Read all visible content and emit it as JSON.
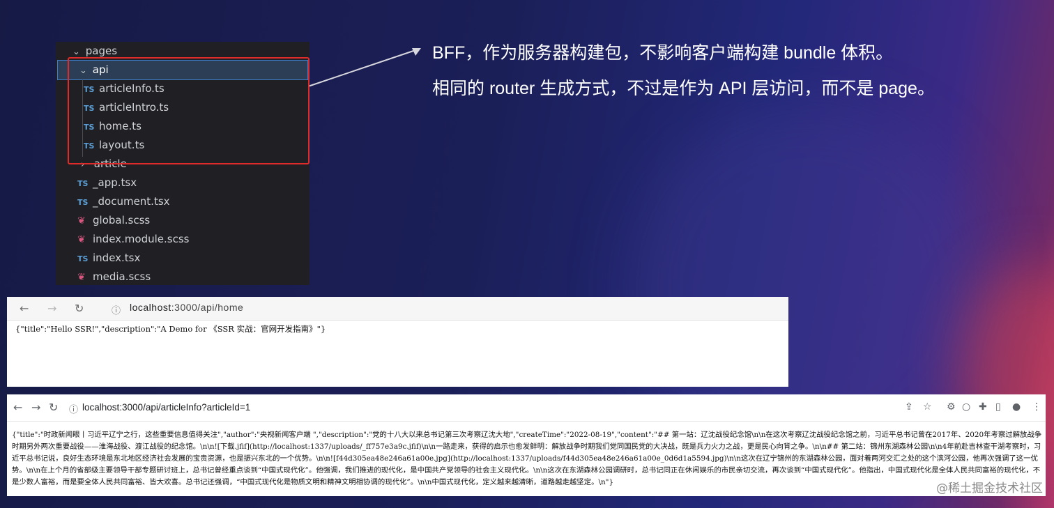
{
  "file_tree": {
    "items": [
      {
        "label": "pages",
        "kind": "folder-open"
      },
      {
        "label": "api",
        "kind": "folder-open",
        "selected": true
      },
      {
        "label": "articleInfo.ts",
        "kind": "ts"
      },
      {
        "label": "articleIntro.ts",
        "kind": "ts"
      },
      {
        "label": "home.ts",
        "kind": "ts"
      },
      {
        "label": "layout.ts",
        "kind": "ts"
      },
      {
        "label": "article",
        "kind": "folder-closed"
      },
      {
        "label": "_app.tsx",
        "kind": "ts"
      },
      {
        "label": "_document.tsx",
        "kind": "ts"
      },
      {
        "label": "global.scss",
        "kind": "scss"
      },
      {
        "label": "index.module.scss",
        "kind": "scss"
      },
      {
        "label": "index.tsx",
        "kind": "ts"
      },
      {
        "label": "media.scss",
        "kind": "scss"
      }
    ],
    "ts_badge": "TS"
  },
  "description": {
    "line1": "BFF，作为服务器构建包，不影响客户端构建 bundle 体积。",
    "line2": "相同的 router 生成方式，不过是作为 API 层访问，而不是 page。"
  },
  "browser_home": {
    "url_host": "localhost",
    "url_rest": ":3000/api/home",
    "body": "{\"title\":\"Hello SSR!\",\"description\":\"A Demo for 《SSR 实战：官网开发指南》\"}"
  },
  "browser_article": {
    "url": "localhost:3000/api/articleInfo?articleId=1",
    "body": "{\"title\":\"时政新闻眼丨习近平辽宁之行，这些重要信息值得关注\",\"author\":\"央视新闻客户端 \",\"description\":\"党的十八大以来总书记第三次考察辽沈大地\",\"createTime\":\"2022-08-19\",\"content\":\"## 第一站：辽沈战役纪念馆\\n\\n在这次考察辽沈战役纪念馆之前，习近平总书记曾在2017年、2020年考察过解放战争时期另外两次重要战役——淮海战役、渡江战役的纪念馆。\\n\\n![下载.jfif](http://localhost:1337/uploads/_ff757e3a9c.jfif)\\n\\n一路走来，获得的启示也愈发鲜明：解放战争时期我们党同国民党的大决战，既是兵力火力之战，更是民心向背之争。\\n\\n## 第二站：锦州东湖森林公园\\n\\n4年前赴吉林查干湖考察时，习近平总书记说，良好生态环境是东北地区经济社会发展的宝贵资源，也是振兴东北的一个优势。\\n\\n![f44d305ea48e246a61a00e.jpg](http://localhost:1337/uploads/f44d305ea48e246a61a00e_0d6d1a5594.jpg)\\n\\n这次在辽宁锦州的东湖森林公园，面对着两河交汇之处的这个滨河公园，他再次强调了这一优势。\\n\\n在上个月的省部级主要领导干部专题研讨班上，总书记曾经重点谈到“中国式现代化”。他强调，我们推进的现代化，是中国共产党领导的社会主义现代化。\\n\\n这次在东湖森林公园调研时，总书记同正在休闲娱乐的市民亲切交流，再次谈到“中国式现代化”。他指出，中国式现代化是全体人民共同富裕的现代化，不是少数人富裕，而是要全体人民共同富裕、皆大欢喜。总书记还强调，“中国式现代化是物质文明和精神文明相协调的现代化”。\\n\\n中国式现代化，定义越来越清晰，道路越走越坚定。\\n\"}"
  },
  "watermark": "@稀土掘金技术社区",
  "colors": {
    "highlight": "#e02b2b",
    "ts": "#5c9fd6",
    "scss": "#d9577f"
  }
}
